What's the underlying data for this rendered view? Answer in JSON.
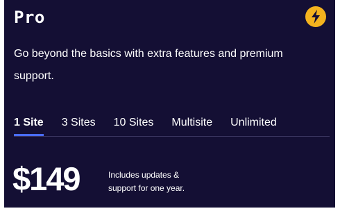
{
  "plan": {
    "title": "Pro",
    "icon": "lightning-bolt-icon",
    "description": "Go beyond the basics with extra features and premium support."
  },
  "tabs": [
    {
      "label": "1 Site",
      "active": true
    },
    {
      "label": "3 Sites",
      "active": false
    },
    {
      "label": "10 Sites",
      "active": false
    },
    {
      "label": "Multisite",
      "active": false
    },
    {
      "label": "Unlimited",
      "active": false
    }
  ],
  "pricing": {
    "price": "$149",
    "note_line1": "Includes updates &",
    "note_line2": "support for one year."
  },
  "colors": {
    "card_background": "#140f34",
    "accent": "#4a6cf7",
    "icon_background": "#f4b31e"
  }
}
